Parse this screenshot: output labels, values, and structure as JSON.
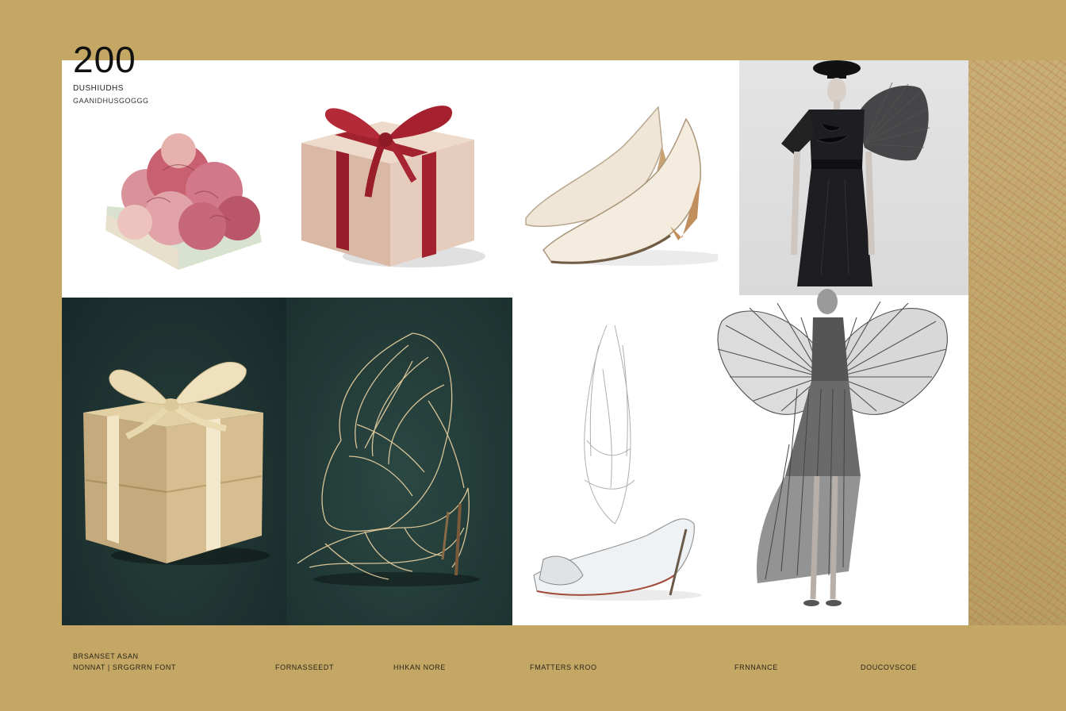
{
  "header": {
    "number": "200",
    "subtitle_line1": "DUSHIUDHS",
    "subtitle_line2": "GAANIDHUSGOGGG"
  },
  "footer": {
    "caption1_line1": "BRSANSET  ASAN",
    "caption1_line2": "NONNAT | SRGGRRN  FONT",
    "caption2": "FORNASSEEDT",
    "caption3": "HHKAN NORE",
    "caption4": "FMATTERS KROO",
    "caption5": "FRNNANCE",
    "caption6": "DOUCOVSCOE"
  },
  "palette": {
    "background": "#c4a764",
    "dark_panel": "#1f3533",
    "ribbon_red": "#a2232f",
    "kraft": "#cdb58a"
  },
  "images": [
    {
      "name": "pink-flower-bouquet"
    },
    {
      "name": "gift-box-red-ribbon"
    },
    {
      "name": "cream-leather-pumps"
    },
    {
      "name": "black-dress-fan-sleeve"
    },
    {
      "name": "kraft-gift-box-cream-ribbon"
    },
    {
      "name": "gold-wire-sculptural-heels"
    },
    {
      "name": "clear-sculptural-stiletto"
    },
    {
      "name": "pleated-fan-wing-gown"
    }
  ]
}
